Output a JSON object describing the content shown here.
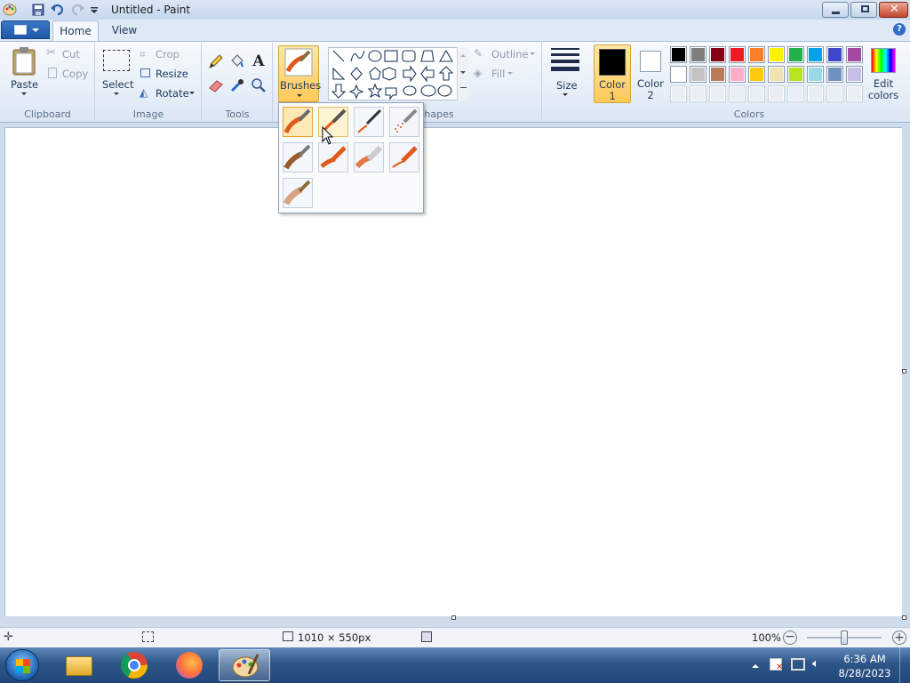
{
  "window": {
    "title": "Untitled - Paint"
  },
  "tabs": [
    {
      "label": "Home"
    },
    {
      "label": "View"
    }
  ],
  "clipboard": {
    "paste": "Paste",
    "cut": "Cut",
    "copy": "Copy",
    "group": "Clipboard"
  },
  "image": {
    "select": "Select",
    "crop": "Crop",
    "resize": "Resize",
    "rotate": "Rotate",
    "group": "Image"
  },
  "tools": {
    "group": "Tools"
  },
  "brushes": {
    "label": "Brushes"
  },
  "shapes": {
    "group": "hapes",
    "outline": "Outline",
    "fill": "Fill"
  },
  "size": {
    "label": "Size"
  },
  "colors": {
    "color1": "Color 1",
    "color2": "Color 2",
    "edit": "Edit colors",
    "group": "Colors",
    "row1": [
      "#000000",
      "#7f7f7f",
      "#880015",
      "#ed1c24",
      "#ff7f27",
      "#fff200",
      "#22b14c",
      "#00a2e8",
      "#3f48cc",
      "#a349a4"
    ],
    "row2": [
      "#ffffff",
      "#c3c3c3",
      "#b97a57",
      "#ffaec9",
      "#ffc90e",
      "#efe4b0",
      "#b5e61d",
      "#99d9ea",
      "#7092be",
      "#c8bfe7"
    ],
    "current1": "#000000",
    "current2": "#ffffff"
  },
  "status": {
    "dimensions": "1010 × 550px",
    "zoom": "100%"
  },
  "clock": {
    "time": "6:36 AM",
    "date": "8/28/2023"
  }
}
